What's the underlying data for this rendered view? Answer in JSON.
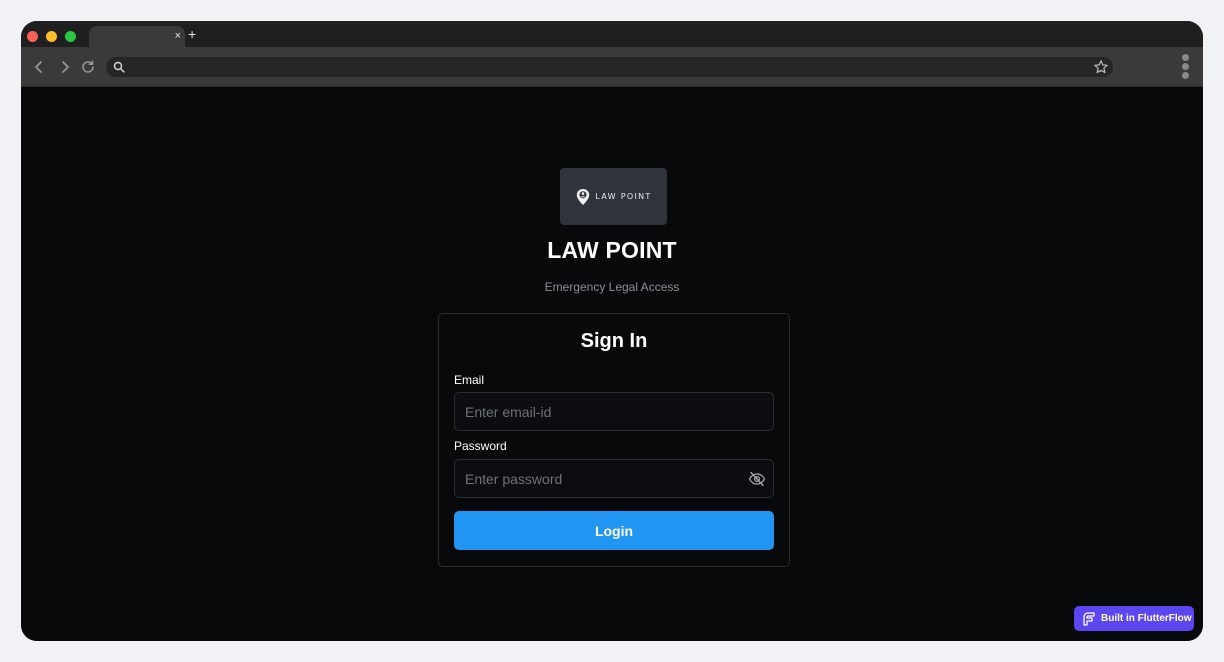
{
  "browser": {
    "tab_close": "×",
    "new_tab": "+"
  },
  "brand": {
    "logo_text": "LAW POINT",
    "title": "LAW POINT",
    "subtitle": "Emergency Legal Access"
  },
  "signin": {
    "heading": "Sign In",
    "email_label": "Email",
    "email_placeholder": "Enter email-id",
    "password_label": "Password",
    "password_placeholder": "Enter password",
    "login_label": "Login"
  },
  "badge": {
    "label": "Built in FlutterFlow"
  },
  "colors": {
    "primary": "#2196f3",
    "background": "#08090b",
    "badge": "#5b46f0"
  }
}
